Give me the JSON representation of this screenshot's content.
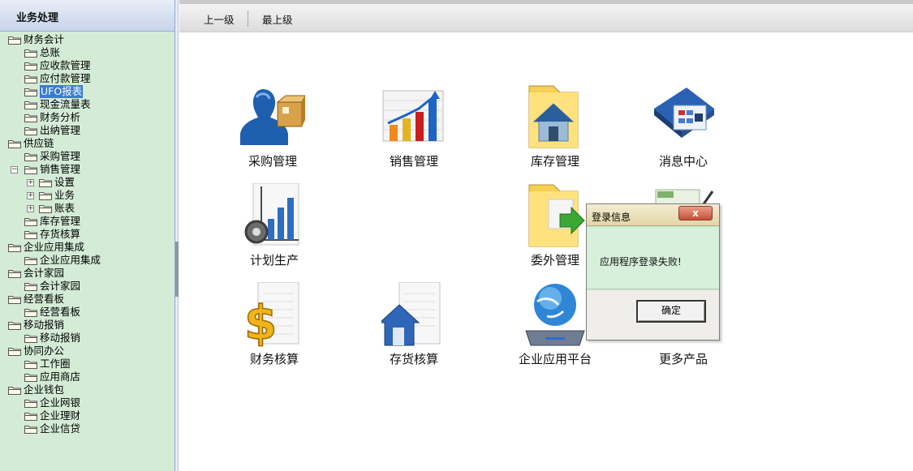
{
  "sidebar": {
    "title": "业务处理",
    "tree": [
      {
        "label": "财务会计",
        "level": 0
      },
      {
        "label": "总账",
        "level": 1
      },
      {
        "label": "应收款管理",
        "level": 1
      },
      {
        "label": "应付款管理",
        "level": 1
      },
      {
        "label": "UFO报表",
        "level": 1,
        "selected": true
      },
      {
        "label": "现金流量表",
        "level": 1
      },
      {
        "label": "财务分析",
        "level": 1
      },
      {
        "label": "出纳管理",
        "level": 1
      },
      {
        "label": "供应链",
        "level": 0
      },
      {
        "label": "采购管理",
        "level": 1
      },
      {
        "label": "销售管理",
        "level": 1,
        "expanded": true
      },
      {
        "label": "设置",
        "level": 2
      },
      {
        "label": "业务",
        "level": 2
      },
      {
        "label": "账表",
        "level": 2
      },
      {
        "label": "库存管理",
        "level": 1
      },
      {
        "label": "存货核算",
        "level": 1
      },
      {
        "label": "企业应用集成",
        "level": 0
      },
      {
        "label": "企业应用集成",
        "level": 1
      },
      {
        "label": "会计家园",
        "level": 0
      },
      {
        "label": "会计家园",
        "level": 1
      },
      {
        "label": "经营看板",
        "level": 0
      },
      {
        "label": "经营看板",
        "level": 1
      },
      {
        "label": "移动报销",
        "level": 0
      },
      {
        "label": "移动报销",
        "level": 1
      },
      {
        "label": "协同办公",
        "level": 0
      },
      {
        "label": "工作圈",
        "level": 1
      },
      {
        "label": "应用商店",
        "level": 1
      },
      {
        "label": "企业钱包",
        "level": 0
      },
      {
        "label": "企业网银",
        "level": 1
      },
      {
        "label": "企业理财",
        "level": 1
      },
      {
        "label": "企业信贷",
        "level": 1
      }
    ]
  },
  "toolbar": {
    "up_label": "上一级",
    "top_label": "最上级"
  },
  "apps": [
    {
      "label": "采购管理",
      "icon": "purchase-icon"
    },
    {
      "label": "销售管理",
      "icon": "sales-chart-icon"
    },
    {
      "label": "库存管理",
      "icon": "inventory-icon"
    },
    {
      "label": "消息中心",
      "icon": "message-center-icon"
    },
    {
      "label": "计划生产",
      "icon": "production-plan-icon"
    },
    {
      "label": "委外管理",
      "icon": "outsourcing-icon"
    },
    {
      "label": "财务核算",
      "icon": "finance-accounting-icon"
    },
    {
      "label": "存货核算",
      "icon": "stock-accounting-icon"
    },
    {
      "label": "企业应用平台",
      "icon": "enterprise-platform-icon"
    },
    {
      "label": "更多产品",
      "icon": "more-products-icon"
    }
  ],
  "dialog": {
    "title": "登录信息",
    "close_label": "x",
    "message": "应用程序登录失败!",
    "ok_label": "确定"
  },
  "colors": {
    "sidebar_bg": "#d4ecd6",
    "selected_bg": "#3a7bd5",
    "dialog_body": "#d6f0da"
  }
}
